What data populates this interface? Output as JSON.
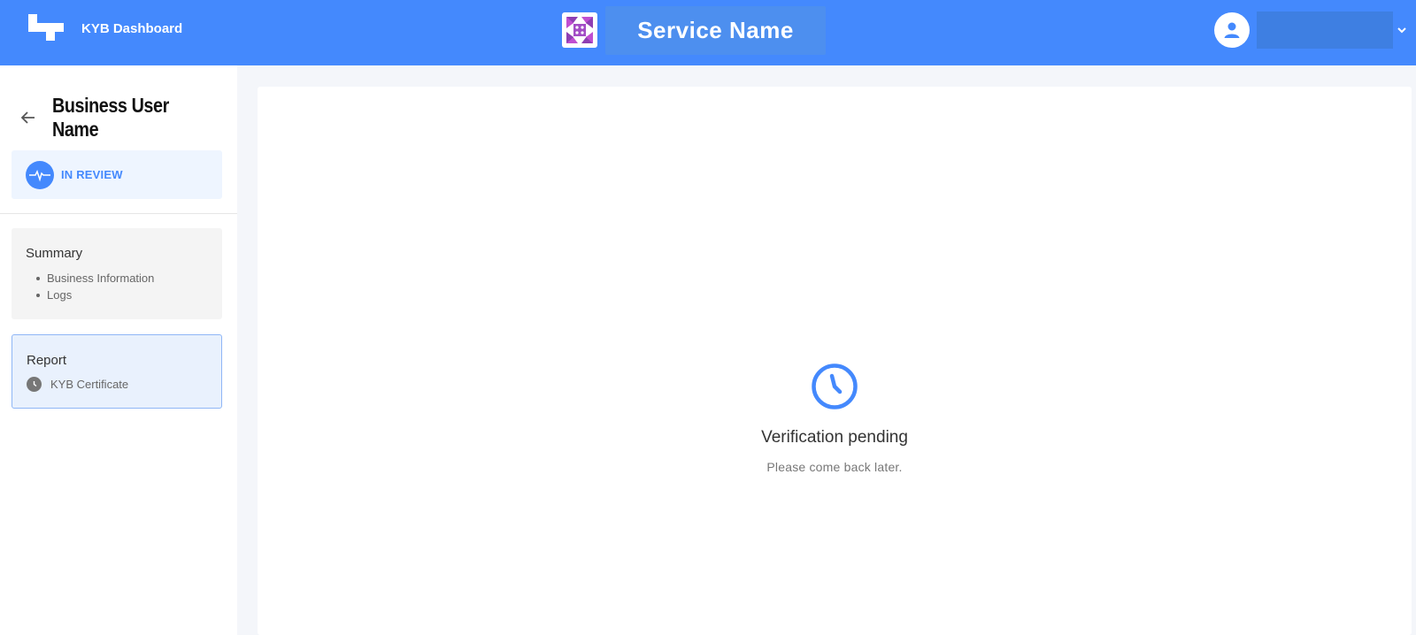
{
  "header": {
    "app_title": "KYB Dashboard",
    "service_name": "Service Name",
    "user_name": "",
    "colors": {
      "bar": "#4489fd",
      "service_box": "#4d8fef",
      "user_box": "#3e7fe2"
    }
  },
  "sidebar": {
    "business_name": "Business User Name",
    "status": "IN REVIEW",
    "summary": {
      "title": "Summary",
      "items": [
        "Business Information",
        "Logs"
      ]
    },
    "report": {
      "title": "Report",
      "item": "KYB Certificate"
    }
  },
  "main": {
    "status_title": "Verification pending",
    "status_subtitle": "Please come back later."
  },
  "icons": {
    "brand": "pixel-blocks-logo",
    "service": "service-logo",
    "user": "user-avatar-icon",
    "dropdown": "chevron-down-icon",
    "back": "arrow-left-icon",
    "status": "pulse-icon",
    "report_item": "clock-icon",
    "pending": "clock-icon"
  }
}
